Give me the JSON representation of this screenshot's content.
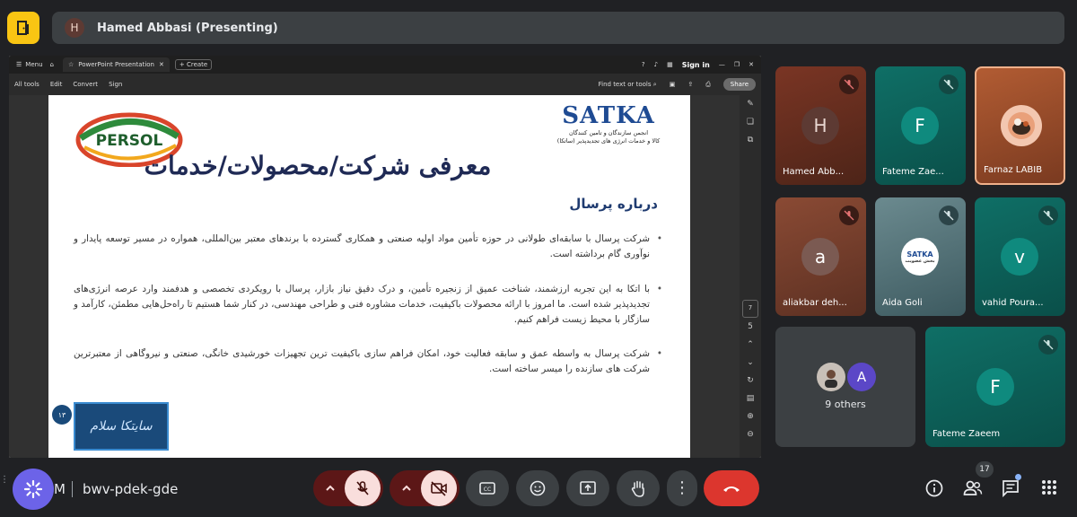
{
  "top": {
    "presenter_initial": "H",
    "presenter_label": "Hamed Abbasi (Presenting)"
  },
  "browser": {
    "menu_label": "Menu",
    "tab_title": "PowerPoint Presentation",
    "create_label": "Create",
    "sign_in": "Sign in",
    "toolbar": {
      "all_tools": "All tools",
      "edit": "Edit",
      "convert": "Convert",
      "sign": "Sign",
      "find": "Find text or tools",
      "share": "Share"
    },
    "page_number": "7",
    "page_total": "5"
  },
  "slide": {
    "satka_logo": "SATKA",
    "satka_subtitle_1": "انجمن سازندگان و تامین کنندگان",
    "satka_subtitle_2": "کالا و خدمات انرژی های تجدیدپذیر (ساتکا)",
    "persol_logo": "PERSOL",
    "title": "معرفی شرکت/محصولات/خدمات",
    "subhead": "درباره پرسال",
    "bullets": [
      "شرکت پرسال با سابقه‌ای طولانی در حوزه تأمین مواد اولیه صنعتی و همکاری گسترده با برندهای معتبر بین‌المللی، همواره در مسیر توسعه پایدار و نوآوری گام برداشته است.",
      "با اتکا به این تجربه ارزشمند، شناخت عمیق از زنجیره تأمین، و درک دقیق نیاز بازار، پرسال با رویکردی تخصصی و هدفمند وارد عرصه انرژی‌های تجدیدپذیر شده است. ما امروز با ارائه محصولات باکیفیت، خدمات مشاوره فنی و طراحی مهندسی، در کنار شما هستیم تا راه‌حل‌هایی مطمئن، کارآمد و سازگار با محیط زیست فراهم کنیم.",
      "شرکت پرسال به واسطه عمق و سابقه فعالیت خود، امکان فراهم سازی باکیفیت ترین تجهیزات خورشیدی خانگی، صنعتی و نیروگاهی از معتبرترین شرکت های سازنده را میسر ساخته است."
    ],
    "stamp_text": "سایتکا سلام",
    "stamp_number": "۱۳"
  },
  "participants": [
    {
      "name": "Hamed Abb...",
      "initial": "H",
      "muted": true
    },
    {
      "name": "Fateme Zae...",
      "initial": "F",
      "muted": true
    },
    {
      "name": "Farnaz LABIB",
      "initial": "",
      "muted": false
    },
    {
      "name": "aliakbar deh...",
      "initial": "a",
      "muted": true
    },
    {
      "name": "Aida Goli",
      "initial": "",
      "muted": true
    },
    {
      "name": "vahid Poura...",
      "initial": "v",
      "muted": true
    },
    {
      "name": "Fateme Zaeem",
      "initial": "F",
      "muted": true
    }
  ],
  "others": {
    "avatar_initial": "A",
    "label": "9 others"
  },
  "aida_logo_text": "SATKA",
  "aida_logo_sub": "بخش عضویت",
  "bottom": {
    "meeting_time_fragment": "M",
    "meeting_code": "bwv-pdek-gde",
    "people_count": "17"
  },
  "colors": {
    "accent_yellow": "#f9c513",
    "end_call": "#dc362e",
    "mic_off_bg": "#f9dedc",
    "speaking_border": "#f0b08a"
  }
}
